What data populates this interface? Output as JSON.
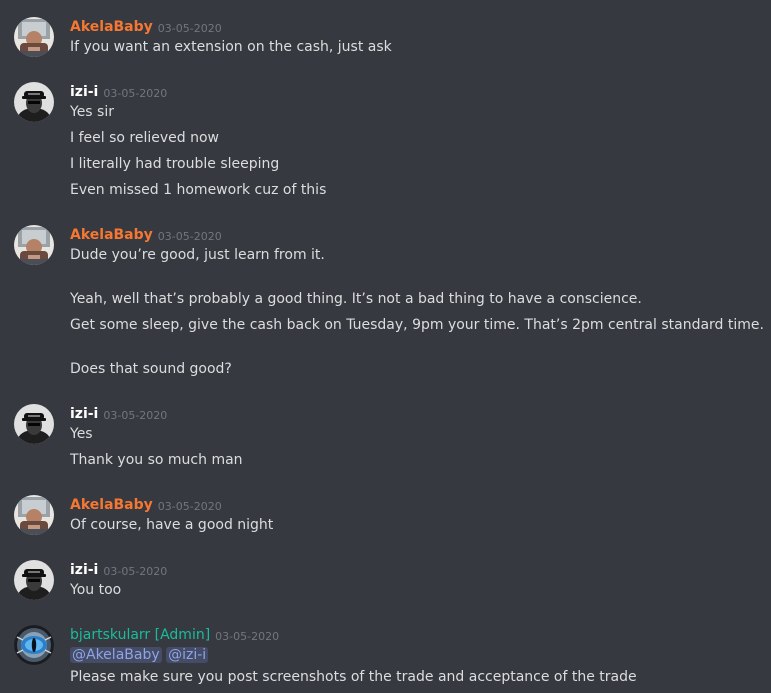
{
  "colors": {
    "background": "#36393f",
    "text": "#dcddde",
    "timestamp": "#72767d",
    "akela_name": "#f57731",
    "izi_name": "#ffffff",
    "admin_name": "#1abc9c",
    "mention_text": "#8fa3e8"
  },
  "messages": [
    {
      "author": "AkelaBaby",
      "avatar_icon": "akelababy-avatar-icon",
      "time": "03-05-2020",
      "lines": [
        "If you want an extension on the cash, just ask"
      ]
    },
    {
      "author": "izi-i",
      "avatar_icon": "izi-i-avatar-icon",
      "time": "03-05-2020",
      "lines": [
        "Yes sir",
        "I feel so relieved now",
        "I literally had trouble sleeping",
        "Even missed 1 homework cuz of this"
      ]
    },
    {
      "author": "AkelaBaby",
      "avatar_icon": "akelababy-avatar-icon",
      "time": "03-05-2020",
      "lines": [
        "Dude you’re good, just learn from it.",
        "Yeah, well that’s probably a good thing. It’s not a bad thing to have a conscience.",
        "Get some sleep, give the cash back on Tuesday, 9pm your time. That’s 2pm central standard time.",
        "Does that sound good?"
      ]
    },
    {
      "author": "izi-i",
      "avatar_icon": "izi-i-avatar-icon",
      "time": "03-05-2020",
      "lines": [
        "Yes",
        "Thank you so much man"
      ]
    },
    {
      "author": "AkelaBaby",
      "avatar_icon": "akelababy-avatar-icon",
      "time": "03-05-2020",
      "lines": [
        "Of course, have a good night"
      ]
    },
    {
      "author": "izi-i",
      "avatar_icon": "izi-i-avatar-icon",
      "time": "03-05-2020",
      "lines": [
        "You too"
      ]
    },
    {
      "author": "bjartskularr [Admin]",
      "avatar_icon": "dragon-eye-avatar-icon",
      "time": "03-05-2020",
      "mentions": [
        "@AkelaBaby",
        "@izi-i"
      ],
      "lines": [
        "Please make sure you post screenshots of the trade and acceptance of the trade"
      ]
    }
  ]
}
